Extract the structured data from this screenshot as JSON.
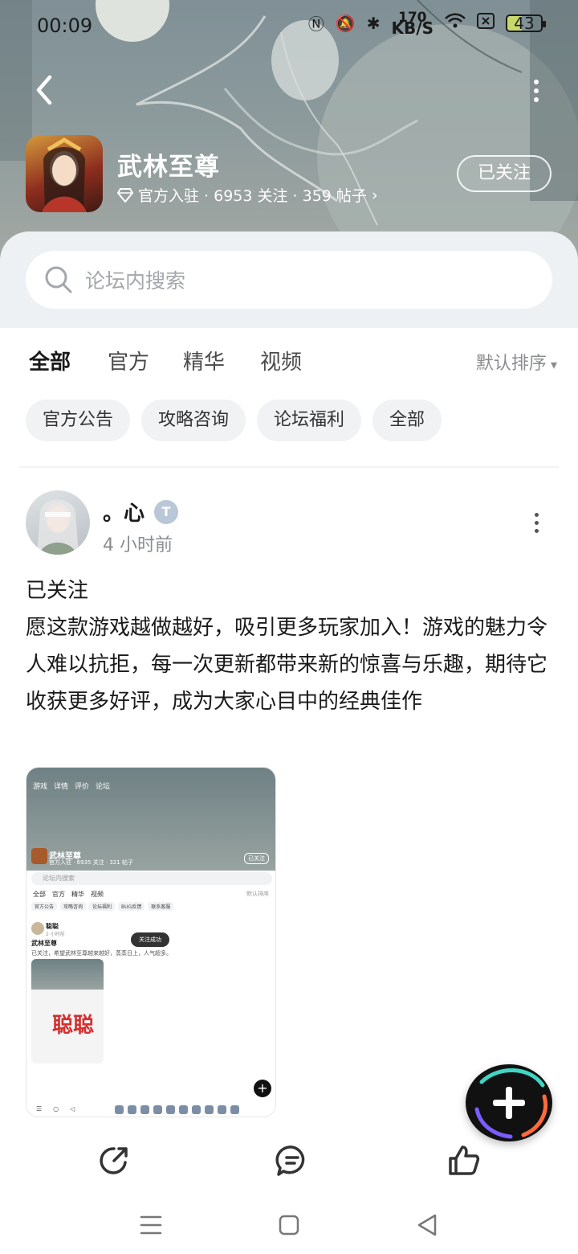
{
  "status_bar": {
    "time": "00:09",
    "speed_value": "170",
    "speed_unit": "KB/S",
    "battery": "43",
    "icons": [
      "nfc-icon",
      "mute-icon",
      "bluetooth-icon",
      "wifi-icon",
      "sim-off-icon"
    ]
  },
  "header": {
    "game_title": "武林至尊",
    "meta": "官方入驻 · 6953 关注 · 359 帖子",
    "follow_label": "已关注"
  },
  "search": {
    "placeholder": "论坛内搜索"
  },
  "tabs": [
    {
      "label": "全部",
      "active": true
    },
    {
      "label": "官方",
      "active": false
    },
    {
      "label": "精华",
      "active": false
    },
    {
      "label": "视频",
      "active": false
    }
  ],
  "sort_label": "默认排序",
  "chips": [
    "官方公告",
    "攻略咨询",
    "论坛福利",
    "全部"
  ],
  "post": {
    "author": "。心",
    "badge": "T",
    "time": "4 小时前",
    "line1": "已关注",
    "content": "愿这款游戏越做越好，吸引更多玩家加入！游戏的魅力令人难以抗拒，每一次更新都带来新的惊喜与乐趣，期待它收获更多好评，成为大家心目中的经典佳作",
    "thumbnail": {
      "nav": [
        "游戏",
        "详情",
        "评价",
        "论坛"
      ],
      "title": "武林至尊",
      "meta": "官方入驻 · 6935 关注 · 321 帖子",
      "follow": "已关注",
      "search": "论坛内搜索",
      "tabs": [
        "全部",
        "官方",
        "精华",
        "视频"
      ],
      "sort": "默认排序",
      "chips": [
        "官方公告",
        "攻略咨询",
        "论坛福利",
        "BUG反馈",
        "联系客服"
      ],
      "author": "聪聪",
      "time": "2 小时前",
      "post_title": "武林至尊",
      "post_text": "已关注，希望武林至尊越来越好，蒸蒸日上，人气超多。",
      "toast": "关注成功",
      "overlay_text": "聪聪"
    }
  },
  "fab": {
    "icon": "plus-icon"
  },
  "actions": [
    "share-icon",
    "comment-icon",
    "like-icon"
  ],
  "nav": [
    "menu-icon",
    "home-icon",
    "back-icon"
  ]
}
